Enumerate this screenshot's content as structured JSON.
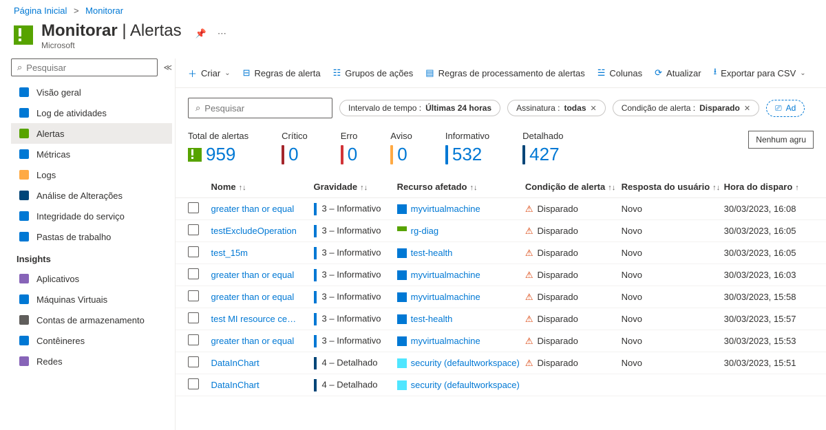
{
  "breadcrumb": {
    "home": "Página Inicial",
    "current": "Monitorar"
  },
  "header": {
    "title": "Monitorar",
    "section": "Alertas",
    "subtitle": "Microsoft"
  },
  "sidebar": {
    "search_placeholder": "Pesquisar",
    "items": [
      {
        "label": "Visão geral",
        "icon": "globe",
        "color": "#0078d4"
      },
      {
        "label": "Log de atividades",
        "icon": "log",
        "color": "#0078d4"
      },
      {
        "label": "Alertas",
        "icon": "alert",
        "color": "#57a300",
        "active": true
      },
      {
        "label": "Métricas",
        "icon": "metrics",
        "color": "#0078d4"
      },
      {
        "label": "Logs",
        "icon": "logs",
        "color": "#ffaa44"
      },
      {
        "label": "Análise de Alterações",
        "icon": "change",
        "color": "#004578"
      },
      {
        "label": "Integridade do serviço",
        "icon": "health",
        "color": "#0078d4"
      },
      {
        "label": "Pastas de trabalho",
        "icon": "workbook",
        "color": "#0078d4"
      }
    ],
    "section_label": "Insights",
    "insights": [
      {
        "label": "Aplicativos",
        "color": "#8764b8"
      },
      {
        "label": "Máquinas Virtuais",
        "color": "#0078d4"
      },
      {
        "label": "Contas de armazenamento",
        "color": "#605e5c"
      },
      {
        "label": "Contêineres",
        "color": "#0078d4"
      },
      {
        "label": "Redes",
        "color": "#8764b8"
      }
    ]
  },
  "toolbar": {
    "create": "Criar",
    "rules": "Regras de alerta",
    "groups": "Grupos de ações",
    "processing": "Regras de processamento de alertas",
    "columns": "Colunas",
    "refresh": "Atualizar",
    "export": "Exportar para CSV"
  },
  "filters": {
    "search_placeholder": "Pesquisar",
    "time_label": "Intervalo de tempo : ",
    "time_value": "Últimas 24 horas",
    "sub_label": "Assinatura : ",
    "sub_value": "todas",
    "cond_label": "Condição de alerta : ",
    "cond_value": "Disparado",
    "add": "Ad"
  },
  "summary": {
    "total_label": "Total de alertas",
    "total": "959",
    "crit_label": "Crítico",
    "crit": "0",
    "err_label": "Erro",
    "err": "0",
    "warn_label": "Aviso",
    "warn": "0",
    "info_label": "Informativo",
    "info": "532",
    "verb_label": "Detalhado",
    "verb": "427",
    "grouping": "Nenhum agru"
  },
  "columns": {
    "name": "Nome",
    "severity": "Gravidade",
    "resource": "Recurso afetado",
    "condition": "Condição de alerta",
    "response": "Resposta do usuário",
    "time": "Hora do disparo"
  },
  "rows": [
    {
      "name": "greater than or equal",
      "sev": "3 – Informativo",
      "sevclass": "bar-info",
      "res": "myvirtualmachine",
      "resicon": "vm-icon",
      "cond": "Disparado",
      "resp": "Novo",
      "time": "30/03/2023, 16:08"
    },
    {
      "name": "testExcludeOperation",
      "sev": "3 – Informativo",
      "sevclass": "bar-info",
      "res": "rg-diag",
      "resicon": "rg-icon",
      "cond": "Disparado",
      "resp": "Novo",
      "time": "30/03/2023, 16:05"
    },
    {
      "name": "test_15m",
      "sev": "3 – Informativo",
      "sevclass": "bar-info",
      "res": "test-health",
      "resicon": "vm-icon",
      "cond": "Disparado",
      "resp": "Novo",
      "time": "30/03/2023, 16:05"
    },
    {
      "name": "greater than or equal",
      "sev": "3 – Informativo",
      "sevclass": "bar-info",
      "res": "myvirtualmachine",
      "resicon": "vm-icon",
      "cond": "Disparado",
      "resp": "Novo",
      "time": "30/03/2023, 16:03"
    },
    {
      "name": "greater than or equal",
      "sev": "3 – Informativo",
      "sevclass": "bar-info",
      "res": "myvirtualmachine",
      "resicon": "vm-icon",
      "cond": "Disparado",
      "resp": "Novo",
      "time": "30/03/2023, 15:58"
    },
    {
      "name": "test MI resource ce…",
      "sev": "3 – Informativo",
      "sevclass": "bar-info",
      "res": "test-health",
      "resicon": "vm-icon",
      "cond": "Disparado",
      "resp": "Novo",
      "time": "30/03/2023, 15:57"
    },
    {
      "name": "greater than or equal",
      "sev": "3 – Informativo",
      "sevclass": "bar-info",
      "res": "myvirtualmachine",
      "resicon": "vm-icon",
      "cond": "Disparado",
      "resp": "Novo",
      "time": "30/03/2023, 15:53"
    },
    {
      "name": "DataInChart",
      "sev": "4 – Detalhado",
      "sevclass": "bar-verb",
      "res": "security (defaultworkspace)",
      "resicon": "sec-icon",
      "cond": "Disparado",
      "resp": "Novo",
      "time": "30/03/2023, 15:51"
    },
    {
      "name": "DataInChart",
      "sev": "4 – Detalhado",
      "sevclass": "bar-verb",
      "res": "security (defaultworkspace)",
      "resicon": "sec-icon",
      "cond": "",
      "resp": "",
      "time": ""
    }
  ]
}
